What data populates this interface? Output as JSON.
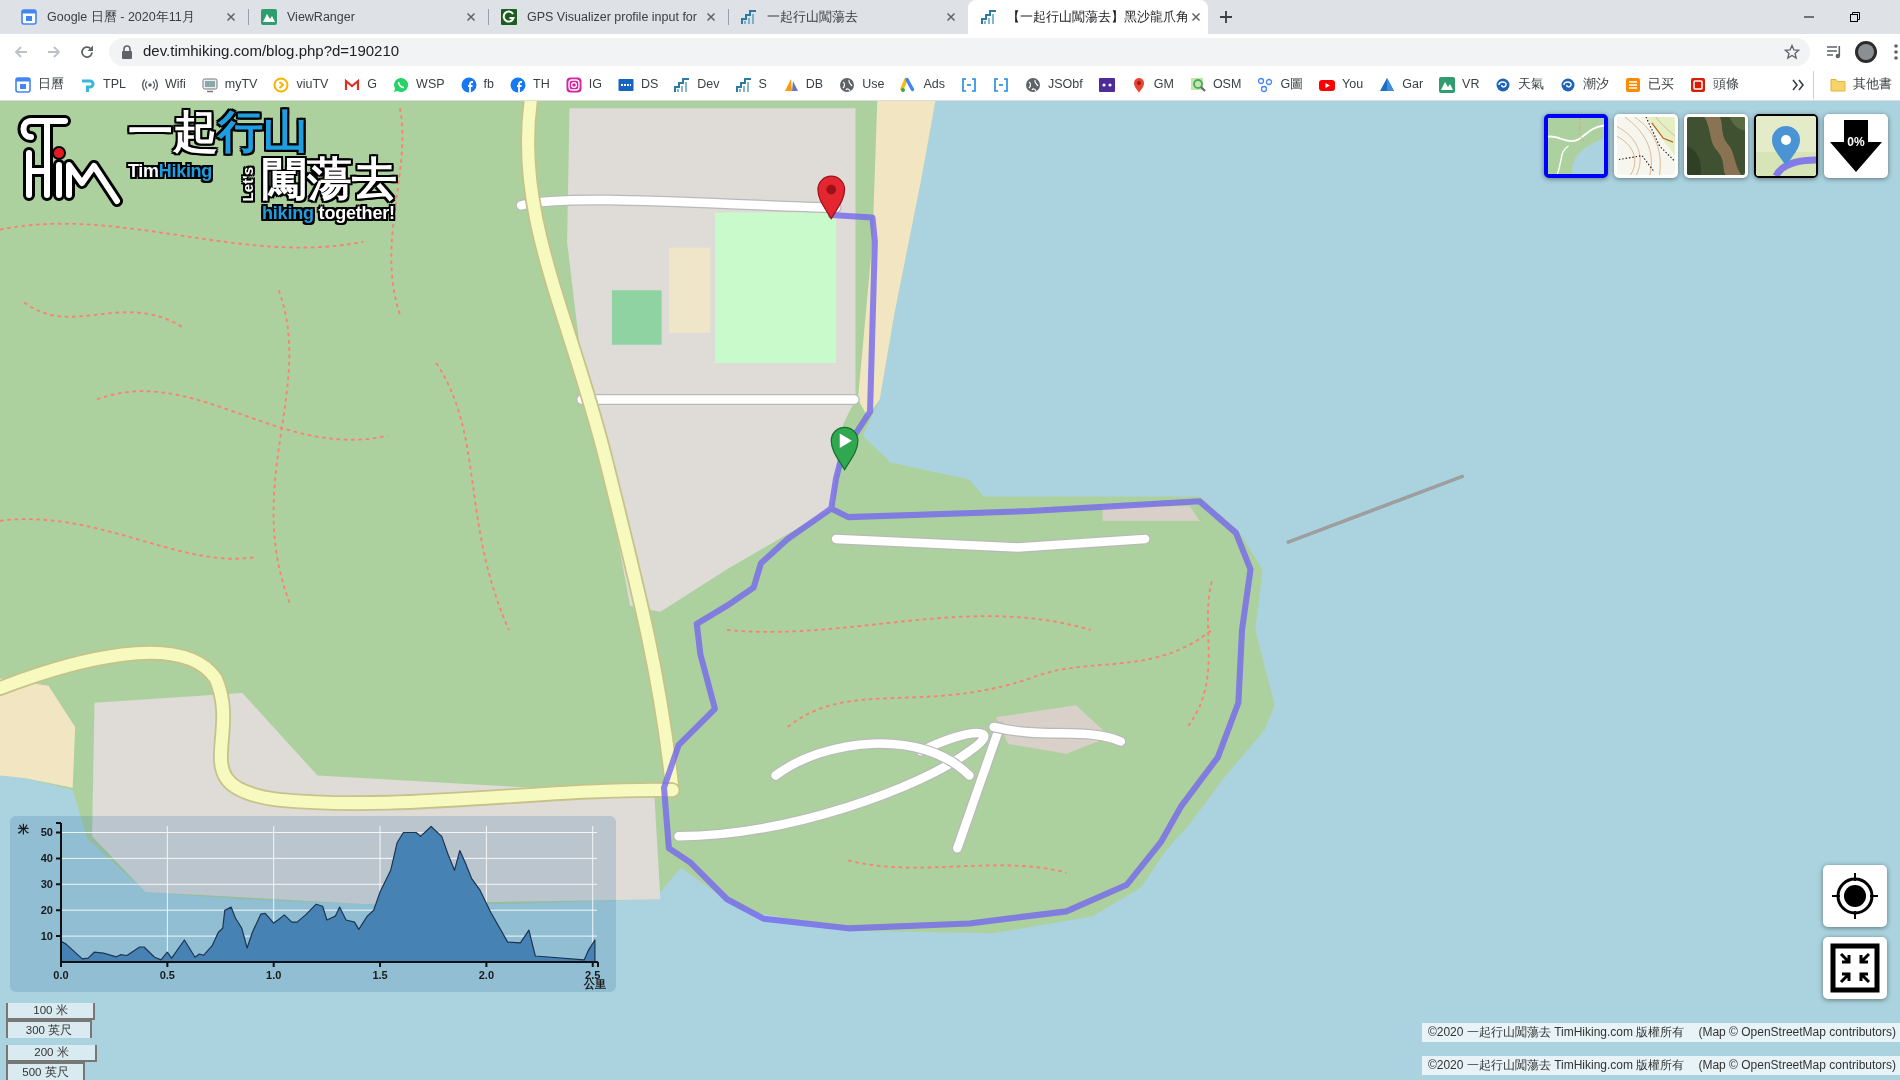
{
  "browser": {
    "tabs": [
      {
        "title": "Google 日曆 - 2020年11月",
        "selected": false
      },
      {
        "title": "ViewRanger",
        "selected": false
      },
      {
        "title": "GPS Visualizer profile input for",
        "selected": false
      },
      {
        "title": "一起行山闖蕩去",
        "selected": false
      },
      {
        "title": "【一起行山闖蕩去】黑沙龍爪角",
        "selected": true
      }
    ],
    "toolbar": {
      "back": {
        "disabled": true
      },
      "forward": {
        "disabled": true
      },
      "address": "dev.timhiking.com/blog.php?d=190210"
    },
    "bookmarks": [
      {
        "kind": "link",
        "label": "日曆"
      },
      {
        "kind": "link",
        "label": "TPL"
      },
      {
        "kind": "link",
        "label": "Wifi"
      },
      {
        "kind": "link",
        "label": "myTV"
      },
      {
        "kind": "link",
        "label": "viuTV"
      },
      {
        "kind": "link",
        "label": "G"
      },
      {
        "kind": "link",
        "label": "WSP"
      },
      {
        "kind": "link",
        "label": "fb"
      },
      {
        "kind": "link",
        "label": "TH"
      },
      {
        "kind": "link",
        "label": "IG"
      },
      {
        "kind": "link",
        "label": "DS"
      },
      {
        "kind": "link",
        "label": "Dev"
      },
      {
        "kind": "link",
        "label": "S"
      },
      {
        "kind": "link",
        "label": "DB"
      },
      {
        "kind": "link",
        "label": "Use"
      },
      {
        "kind": "link",
        "label": "Ads"
      },
      {
        "kind": "icon"
      },
      {
        "kind": "icon"
      },
      {
        "kind": "link",
        "label": "JSObf"
      },
      {
        "kind": "icon"
      },
      {
        "kind": "link",
        "label": "GM"
      },
      {
        "kind": "link",
        "label": "OSM"
      },
      {
        "kind": "link",
        "label": "G圖"
      },
      {
        "kind": "link",
        "label": "You"
      },
      {
        "kind": "link",
        "label": "Gar"
      },
      {
        "kind": "link",
        "label": "VR"
      },
      {
        "kind": "link",
        "label": "天氣"
      },
      {
        "kind": "link",
        "label": "潮汐"
      },
      {
        "kind": "link",
        "label": "已买"
      },
      {
        "kind": "link",
        "label": "頭條"
      }
    ],
    "other_bookmarks": "其他書"
  },
  "map": {
    "logo": {
      "title": [
        {
          "text": "一起",
          "color": "#ffffff"
        },
        {
          "text": "行山",
          "color": "#1e9ee0"
        }
      ],
      "brand": [
        {
          "text": "Tim",
          "color": "#ffffff"
        },
        {
          "text": "Hiking",
          "color": "#1e9ee0"
        }
      ],
      "side_text": "Let's",
      "subtitle": "闖蕩去",
      "tagline": [
        {
          "text": "hiking",
          "color": "#1e9ee0"
        },
        {
          "text": " together!",
          "color": "#ffffff"
        }
      ]
    },
    "layers": [
      {
        "kind": "street",
        "selected": true
      },
      {
        "kind": "topo",
        "selected": false
      },
      {
        "kind": "satellite",
        "selected": false
      }
    ],
    "route_layer": {
      "on": true
    },
    "download": {
      "label": "0%"
    },
    "elevation_profile": {
      "chart_data": {
        "type": "area",
        "xlabel": "公里",
        "ylabel": "米",
        "x": [
          0,
          0.024,
          0.1,
          0.128,
          0.156,
          0.2,
          0.26,
          0.28,
          0.31,
          0.37,
          0.39,
          0.44,
          0.47,
          0.5,
          0.52,
          0.58,
          0.63,
          0.65,
          0.67,
          0.71,
          0.74,
          0.76,
          0.77,
          0.8,
          0.82,
          0.85,
          0.875,
          0.9,
          0.94,
          0.96,
          1.0,
          1.02,
          1.05,
          1.085,
          1.11,
          1.15,
          1.2,
          1.23,
          1.25,
          1.29,
          1.31,
          1.34,
          1.38,
          1.4,
          1.44,
          1.47,
          1.5,
          1.55,
          1.58,
          1.61,
          1.67,
          1.69,
          1.74,
          1.79,
          1.82,
          1.85,
          1.875,
          1.9,
          1.93,
          1.97,
          2.02,
          2.1,
          2.16,
          2.2,
          2.23,
          2.46,
          2.48,
          2.51
        ],
        "values": [
          8,
          6.9,
          1.2,
          1.5,
          3.8,
          3.4,
          2,
          2.8,
          2.5,
          5.8,
          5.8,
          1.8,
          0.8,
          3.8,
          1.5,
          8.5,
          1.8,
          3.1,
          2.6,
          6.2,
          11.5,
          13,
          20,
          21.2,
          17,
          13,
          5.4,
          11.5,
          18.5,
          18.8,
          15,
          16.2,
          18.2,
          15.4,
          15.4,
          18.2,
          22.3,
          21.5,
          16.2,
          17.7,
          21.2,
          16.2,
          15.4,
          12.6,
          17.7,
          20,
          27,
          35.4,
          46,
          50,
          50,
          48.5,
          52.3,
          48.5,
          41.5,
          35.4,
          43,
          38.5,
          32.3,
          27.7,
          19.2,
          7.7,
          7.4,
          12.3,
          2.3,
          0.8,
          4.6,
          8.5
        ],
        "xlim": [
          0,
          2.52
        ],
        "ylim": [
          0,
          52.5
        ],
        "xticks": [
          {
            "value": 0,
            "label": "0.0"
          },
          0.5,
          {
            "value": 1,
            "label": "1.0"
          },
          1.5,
          {
            "value": 2,
            "label": "2.0"
          },
          2.5
        ],
        "yticks": [
          10,
          20,
          30,
          40,
          50
        ],
        "grid": true
      }
    },
    "scale_bars": [
      {
        "metric": "100 米",
        "imperial": "300 英尺"
      },
      {
        "metric": "200 米",
        "imperial": "500 英尺"
      }
    ],
    "attribution": [
      {
        "copyright": {
          "prefix": "©2020 一起行山闖蕩去 ",
          "link": "TimHiking.com",
          "suffix": " 版權所有"
        },
        "credit": {
          "prefix": "(Map © ",
          "link": "OpenStreetMap",
          "suffix": " contributors)"
        }
      },
      {
        "copyright": {
          "prefix": "©2020 一起行山闖蕩去 ",
          "link": "TimHiking.com",
          "suffix": " 版權所有"
        },
        "credit": {
          "prefix": "(Map © ",
          "link": "OpenStreetMap",
          "suffix": " contributors)"
        }
      }
    ]
  }
}
